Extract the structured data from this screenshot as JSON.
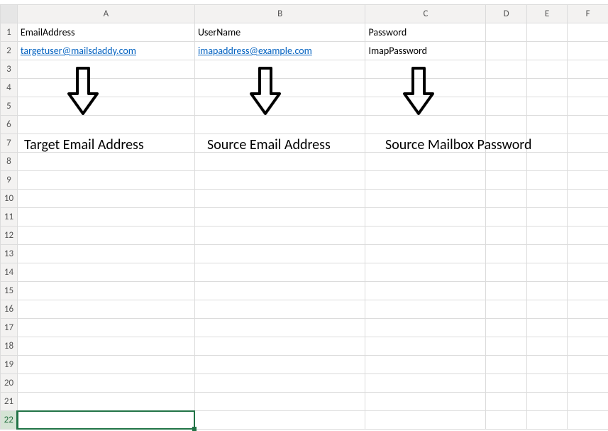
{
  "columns": [
    "A",
    "B",
    "C",
    "D",
    "E",
    "F"
  ],
  "rows": [
    "1",
    "2",
    "3",
    "4",
    "5",
    "6",
    "7",
    "8",
    "9",
    "10",
    "11",
    "12",
    "13",
    "14",
    "15",
    "16",
    "17",
    "18",
    "19",
    "20",
    "21",
    "22"
  ],
  "cells": {
    "A1": "EmailAddress",
    "B1": "UserName",
    "C1": "Password",
    "A2": "targetuser@mailsdaddy.com",
    "B2": "imapaddress@example.com",
    "C2": "ImapPassword"
  },
  "annotations": {
    "labelA": "Target Email Address",
    "labelB": "Source Email Address",
    "labelC": "Source Mailbox Password"
  },
  "active_cell": "A22"
}
